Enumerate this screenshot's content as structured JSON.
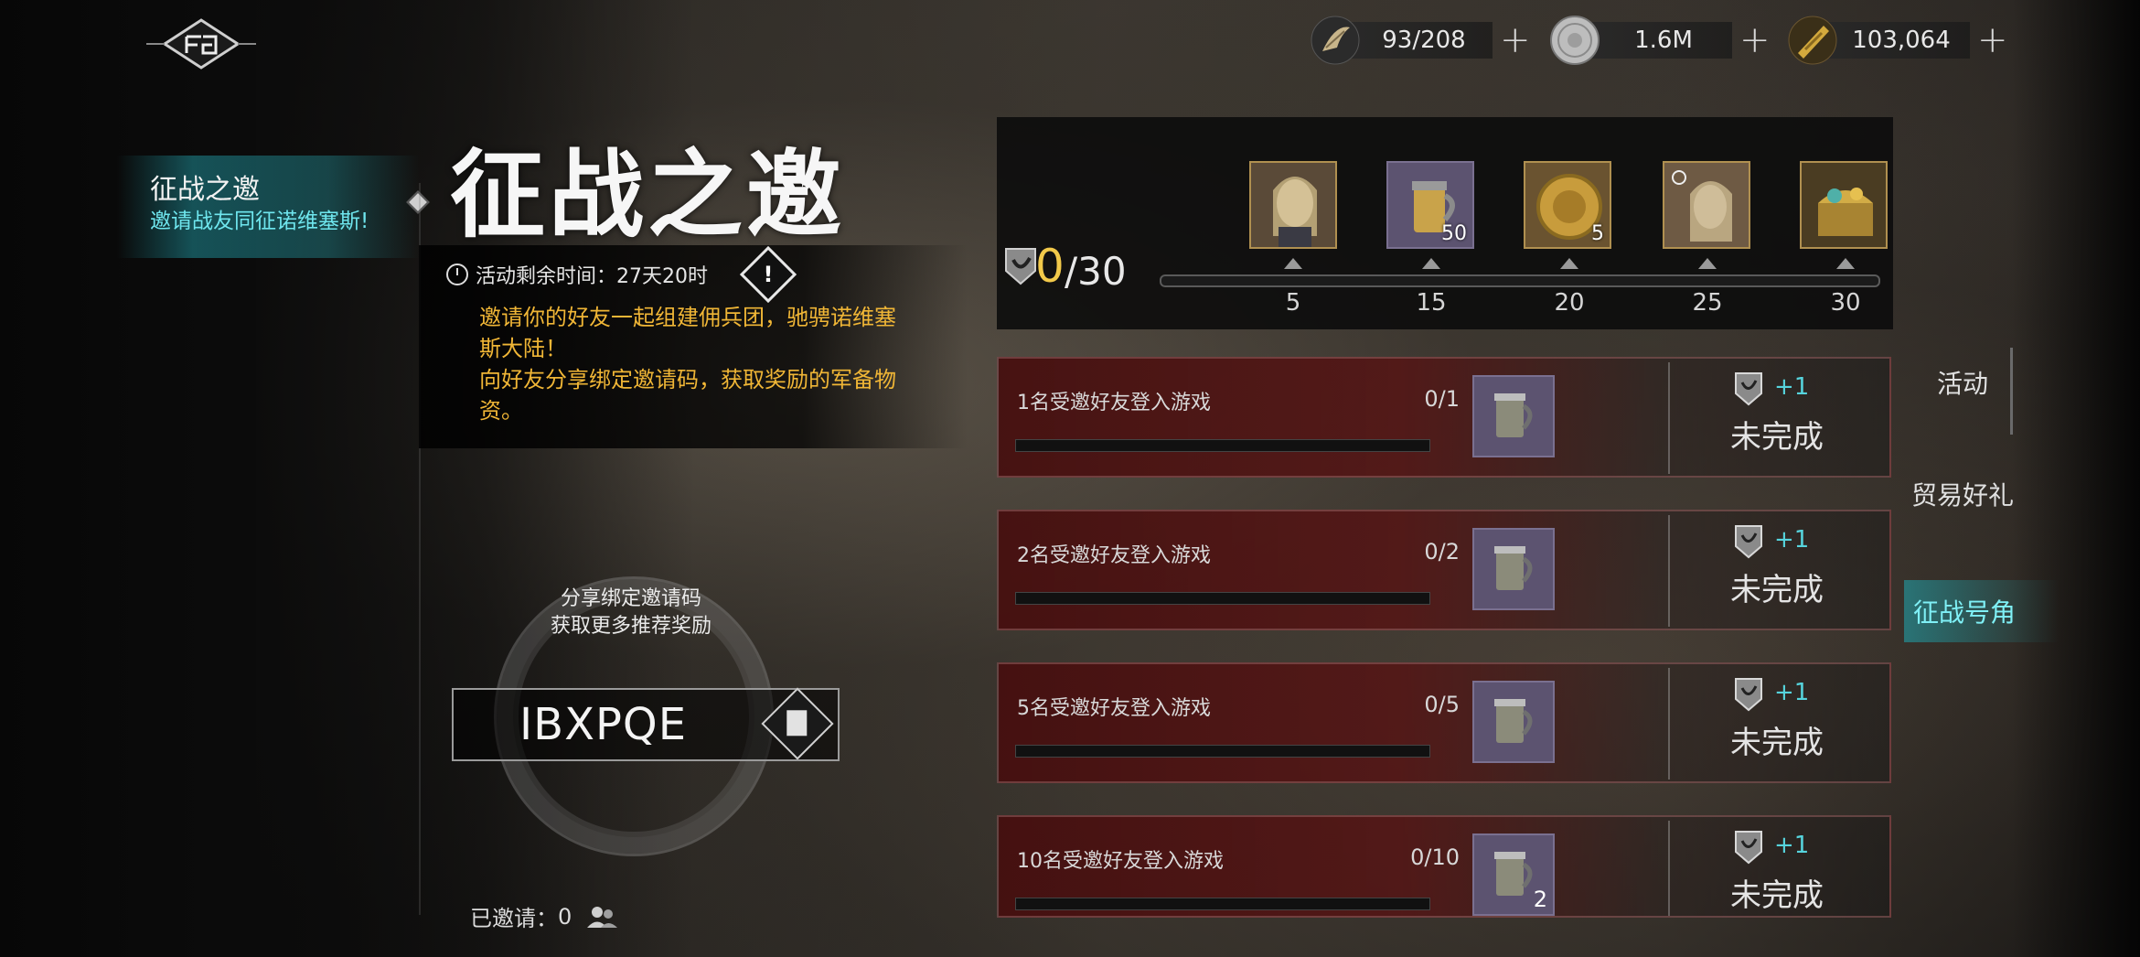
{
  "currencies": [
    {
      "icon": "feather-horn-icon",
      "value": "93/208"
    },
    {
      "icon": "silver-coin-icon",
      "value": "1.6M"
    },
    {
      "icon": "gold-scale-icon",
      "value": "103,064"
    }
  ],
  "plus_symbol": "+",
  "left_tab": {
    "title": "征战之邀",
    "subtitle": "邀请战友同征诺维塞斯!"
  },
  "event": {
    "title": "征战之邀",
    "timer_label": "活动剩余时间：27天20时",
    "description": "邀请你的好友一起组建佣兵团，驰骋诺维塞斯大陆！\n向好友分享绑定邀请码，获取奖励的军备物资。"
  },
  "share": {
    "line1": "分享绑定邀请码",
    "line2": "获取更多推荐奖励",
    "code": "IBXPQE"
  },
  "invited": {
    "label": "已邀请：",
    "count": "0"
  },
  "progress": {
    "current": "0",
    "total": "/30",
    "value": 0,
    "max": 30
  },
  "milestones": [
    {
      "mark": "5",
      "icon": "hero-portrait-icon",
      "qty": ""
    },
    {
      "mark": "15",
      "icon": "tankard-icon",
      "qty": "50"
    },
    {
      "mark": "20",
      "icon": "gold-medal-icon",
      "qty": "5"
    },
    {
      "mark": "25",
      "icon": "hero-skin-icon",
      "qty": ""
    },
    {
      "mark": "30",
      "icon": "treasure-chest-icon",
      "qty": ""
    }
  ],
  "tasks": [
    {
      "label": "1名受邀好友登入游戏",
      "count": "0/1",
      "item_qty": "",
      "reward": "+1",
      "status": "未完成"
    },
    {
      "label": "2名受邀好友登入游戏",
      "count": "0/2",
      "item_qty": "",
      "reward": "+1",
      "status": "未完成"
    },
    {
      "label": "5名受邀好友登入游戏",
      "count": "0/5",
      "item_qty": "",
      "reward": "+1",
      "status": "未完成"
    },
    {
      "label": "10名受邀好友登入游戏",
      "count": "0/10",
      "item_qty": "2",
      "reward": "+1",
      "status": "未完成"
    }
  ],
  "right_tabs": [
    {
      "label": "活动",
      "active": false
    },
    {
      "label": "贸易好礼",
      "active": false
    },
    {
      "label": "征战号角",
      "active": true
    }
  ],
  "colors": {
    "accent_cyan": "#56d4dd",
    "gold_text": "#f0b636",
    "task_red": "#5a1414"
  }
}
